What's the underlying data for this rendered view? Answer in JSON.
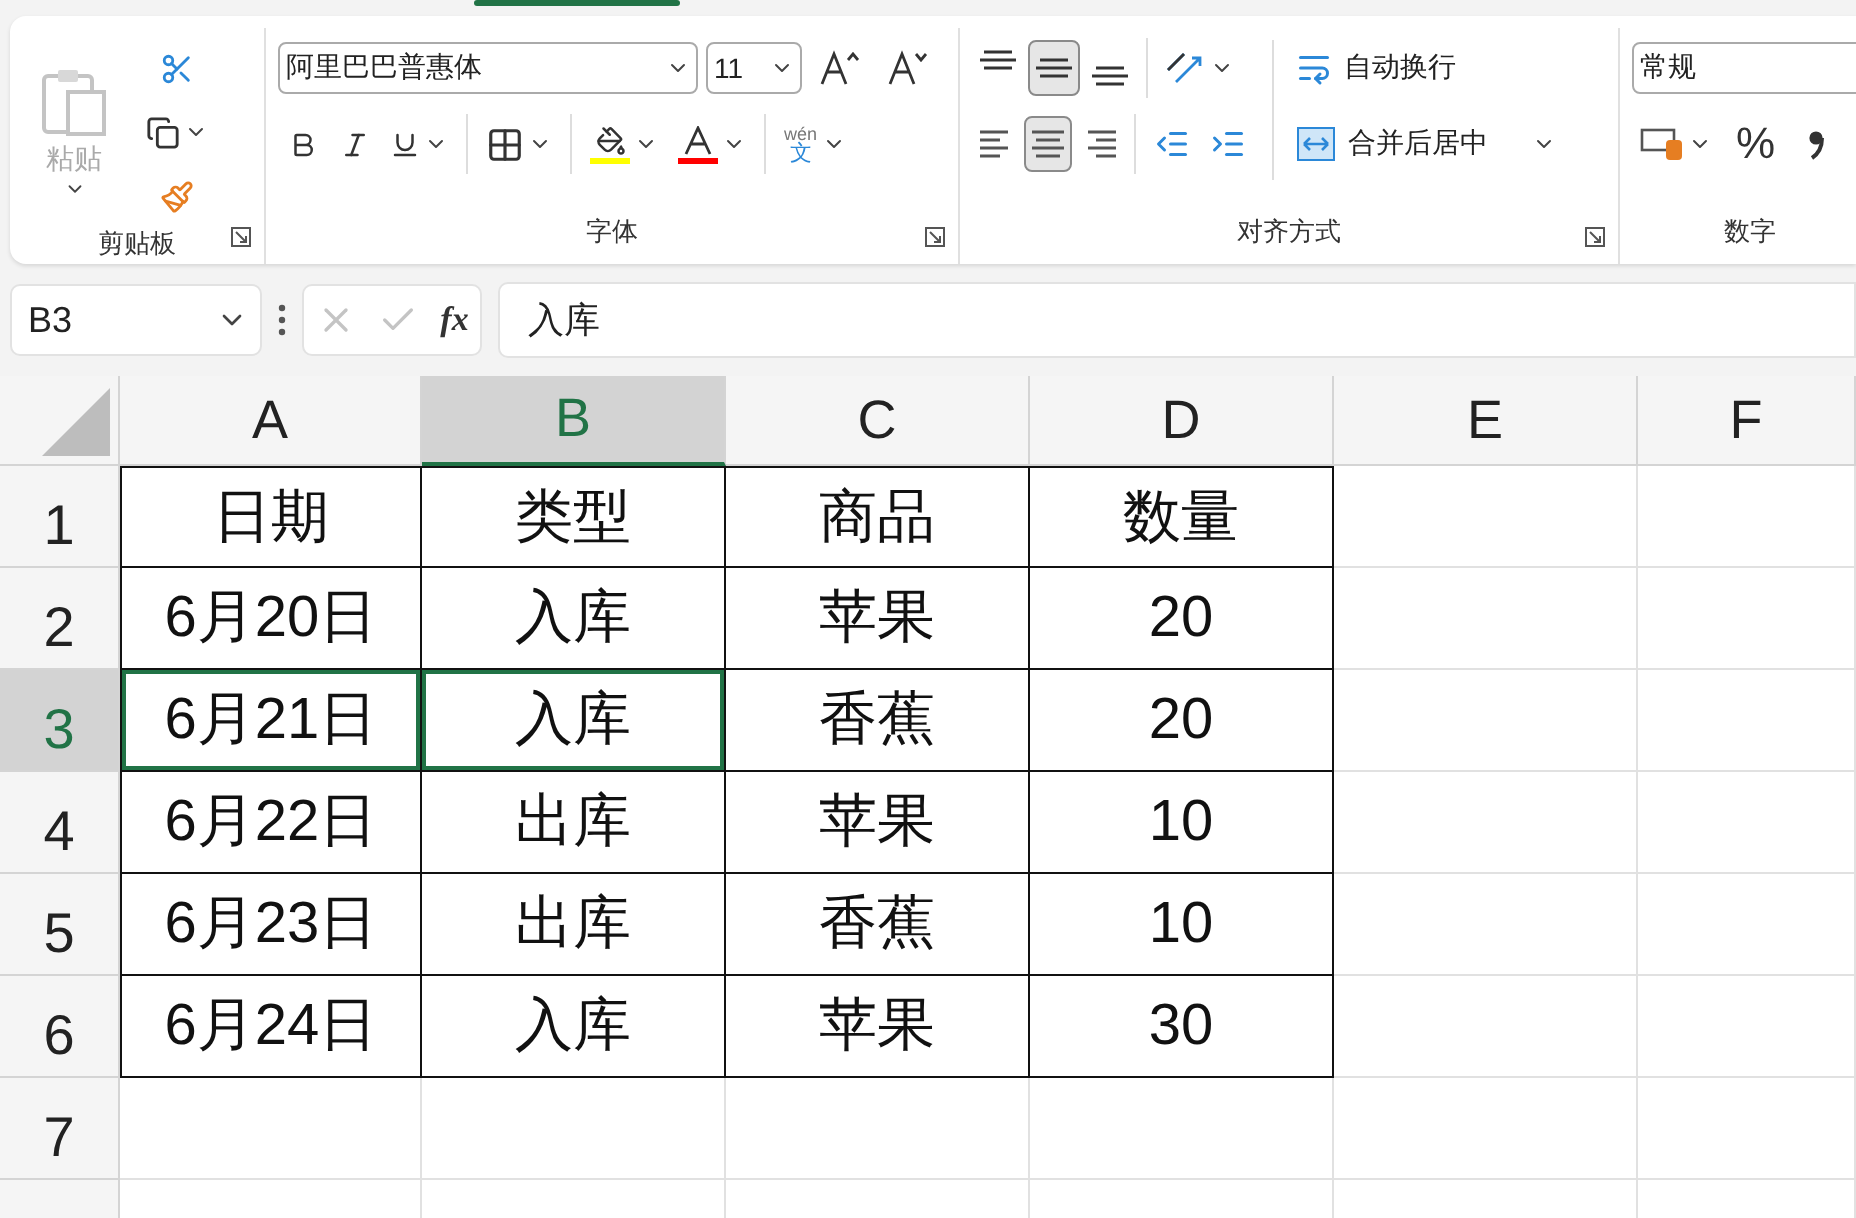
{
  "ribbon": {
    "clipboard": {
      "paste_label": "粘贴",
      "paste_disabled": true,
      "label": "剪贴板"
    },
    "font": {
      "font_name": "阿里巴巴普惠体",
      "font_size": "11",
      "phonetic_top": "wén",
      "phonetic_bottom": "文",
      "label": "字体"
    },
    "alignment": {
      "vertical": [
        {
          "kind": "top",
          "selected": false
        },
        {
          "kind": "middle",
          "selected": true
        },
        {
          "kind": "bottom",
          "selected": false
        }
      ],
      "horizontal": [
        {
          "kind": "left",
          "selected": false
        },
        {
          "kind": "center",
          "selected": true
        },
        {
          "kind": "right",
          "selected": false
        }
      ],
      "wrap_text": "自动换行",
      "merge_center": "合并后居中",
      "label": "对齐方式"
    },
    "number": {
      "format": "常规",
      "percent": "%",
      "label": "数字"
    }
  },
  "formula_bar": {
    "name_box": "B3",
    "function_label": "fx",
    "formula": "入库"
  },
  "sheet": {
    "columns": [
      {
        "label": "A",
        "selected": false
      },
      {
        "label": "B",
        "selected": true
      },
      {
        "label": "C",
        "selected": false
      },
      {
        "label": "D",
        "selected": false
      },
      {
        "label": "E",
        "selected": false
      },
      {
        "label": "F",
        "selected": false
      }
    ],
    "rows": [
      {
        "label": "1",
        "selected": false,
        "cells": [
          {
            "value": "日期",
            "bordered": true,
            "selected": false
          },
          {
            "value": "类型",
            "bordered": true,
            "selected": false
          },
          {
            "value": "商品",
            "bordered": true,
            "selected": false
          },
          {
            "value": "数量",
            "bordered": true,
            "selected": false
          }
        ]
      },
      {
        "label": "2",
        "selected": false,
        "cells": [
          {
            "value": "6月20日",
            "bordered": true,
            "selected": false
          },
          {
            "value": "入库",
            "bordered": true,
            "selected": false
          },
          {
            "value": "苹果",
            "bordered": true,
            "selected": false
          },
          {
            "value": "20",
            "bordered": true,
            "selected": false
          }
        ]
      },
      {
        "label": "3",
        "selected": true,
        "cells": [
          {
            "value": "6月21日",
            "bordered": true,
            "selected": true
          },
          {
            "value": "入库",
            "bordered": true,
            "selected": true
          },
          {
            "value": "香蕉",
            "bordered": true,
            "selected": false
          },
          {
            "value": "20",
            "bordered": true,
            "selected": false
          }
        ]
      },
      {
        "label": "4",
        "selected": false,
        "cells": [
          {
            "value": "6月22日",
            "bordered": true,
            "selected": false
          },
          {
            "value": "出库",
            "bordered": true,
            "selected": false
          },
          {
            "value": "苹果",
            "bordered": true,
            "selected": false
          },
          {
            "value": "10",
            "bordered": true,
            "selected": false
          }
        ]
      },
      {
        "label": "5",
        "selected": false,
        "cells": [
          {
            "value": "6月23日",
            "bordered": true,
            "selected": false
          },
          {
            "value": "出库",
            "bordered": true,
            "selected": false
          },
          {
            "value": "香蕉",
            "bordered": true,
            "selected": false
          },
          {
            "value": "10",
            "bordered": true,
            "selected": false
          }
        ]
      },
      {
        "label": "6",
        "selected": false,
        "cells": [
          {
            "value": "6月24日",
            "bordered": true,
            "selected": false
          },
          {
            "value": "入库",
            "bordered": true,
            "selected": false
          },
          {
            "value": "苹果",
            "bordered": true,
            "selected": false
          },
          {
            "value": "30",
            "bordered": true,
            "selected": false
          }
        ]
      },
      {
        "label": "7",
        "selected": false
      }
    ]
  }
}
